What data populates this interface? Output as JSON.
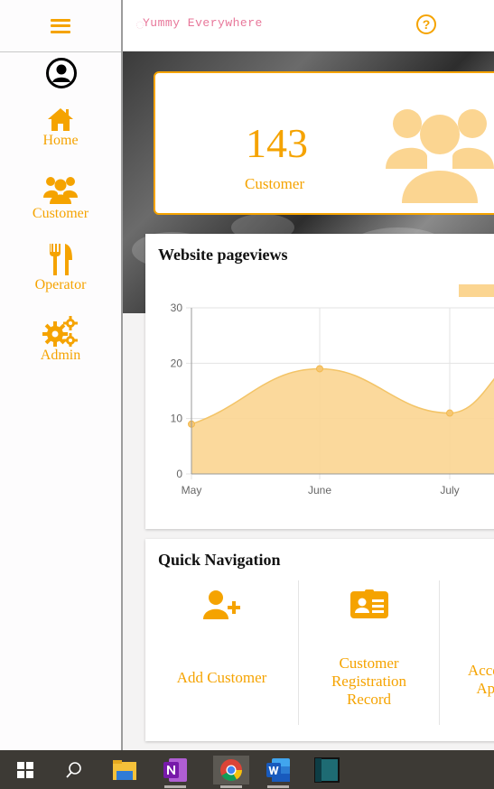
{
  "header": {
    "brand_text": "Yummy Everywhere",
    "help_label": "?"
  },
  "sidebar": {
    "items": [
      {
        "label": "Home",
        "icon": "home-icon"
      },
      {
        "label": "Customer",
        "icon": "users-icon"
      },
      {
        "label": "Operator",
        "icon": "utensils-icon"
      },
      {
        "label": "Admin",
        "icon": "gears-icon"
      }
    ]
  },
  "stats": {
    "value": "143",
    "label": "Customer"
  },
  "chart": {
    "title": "Website pageviews"
  },
  "chart_data": {
    "type": "area",
    "title": "Website pageviews",
    "categories": [
      "May",
      "June",
      "July"
    ],
    "series": [
      {
        "values": [
          9,
          19,
          11
        ]
      }
    ],
    "yticks": [
      "0",
      "10",
      "20",
      "30"
    ],
    "ylim": [
      0,
      30
    ],
    "grid": true,
    "legend": "top-right",
    "color": "#fbd591"
  },
  "quick_nav": {
    "title": "Quick Navigation",
    "items": [
      {
        "label": "Add Customer",
        "icon": "add-user-icon"
      },
      {
        "label": "Customer Registration Record",
        "icon": "id-card-icon"
      },
      {
        "label": "Accept App",
        "icon": "approve-icon"
      }
    ]
  },
  "colors": {
    "accent": "#f5a300",
    "chart_fill": "#fbd591",
    "taskbar": "#3d3a35"
  }
}
